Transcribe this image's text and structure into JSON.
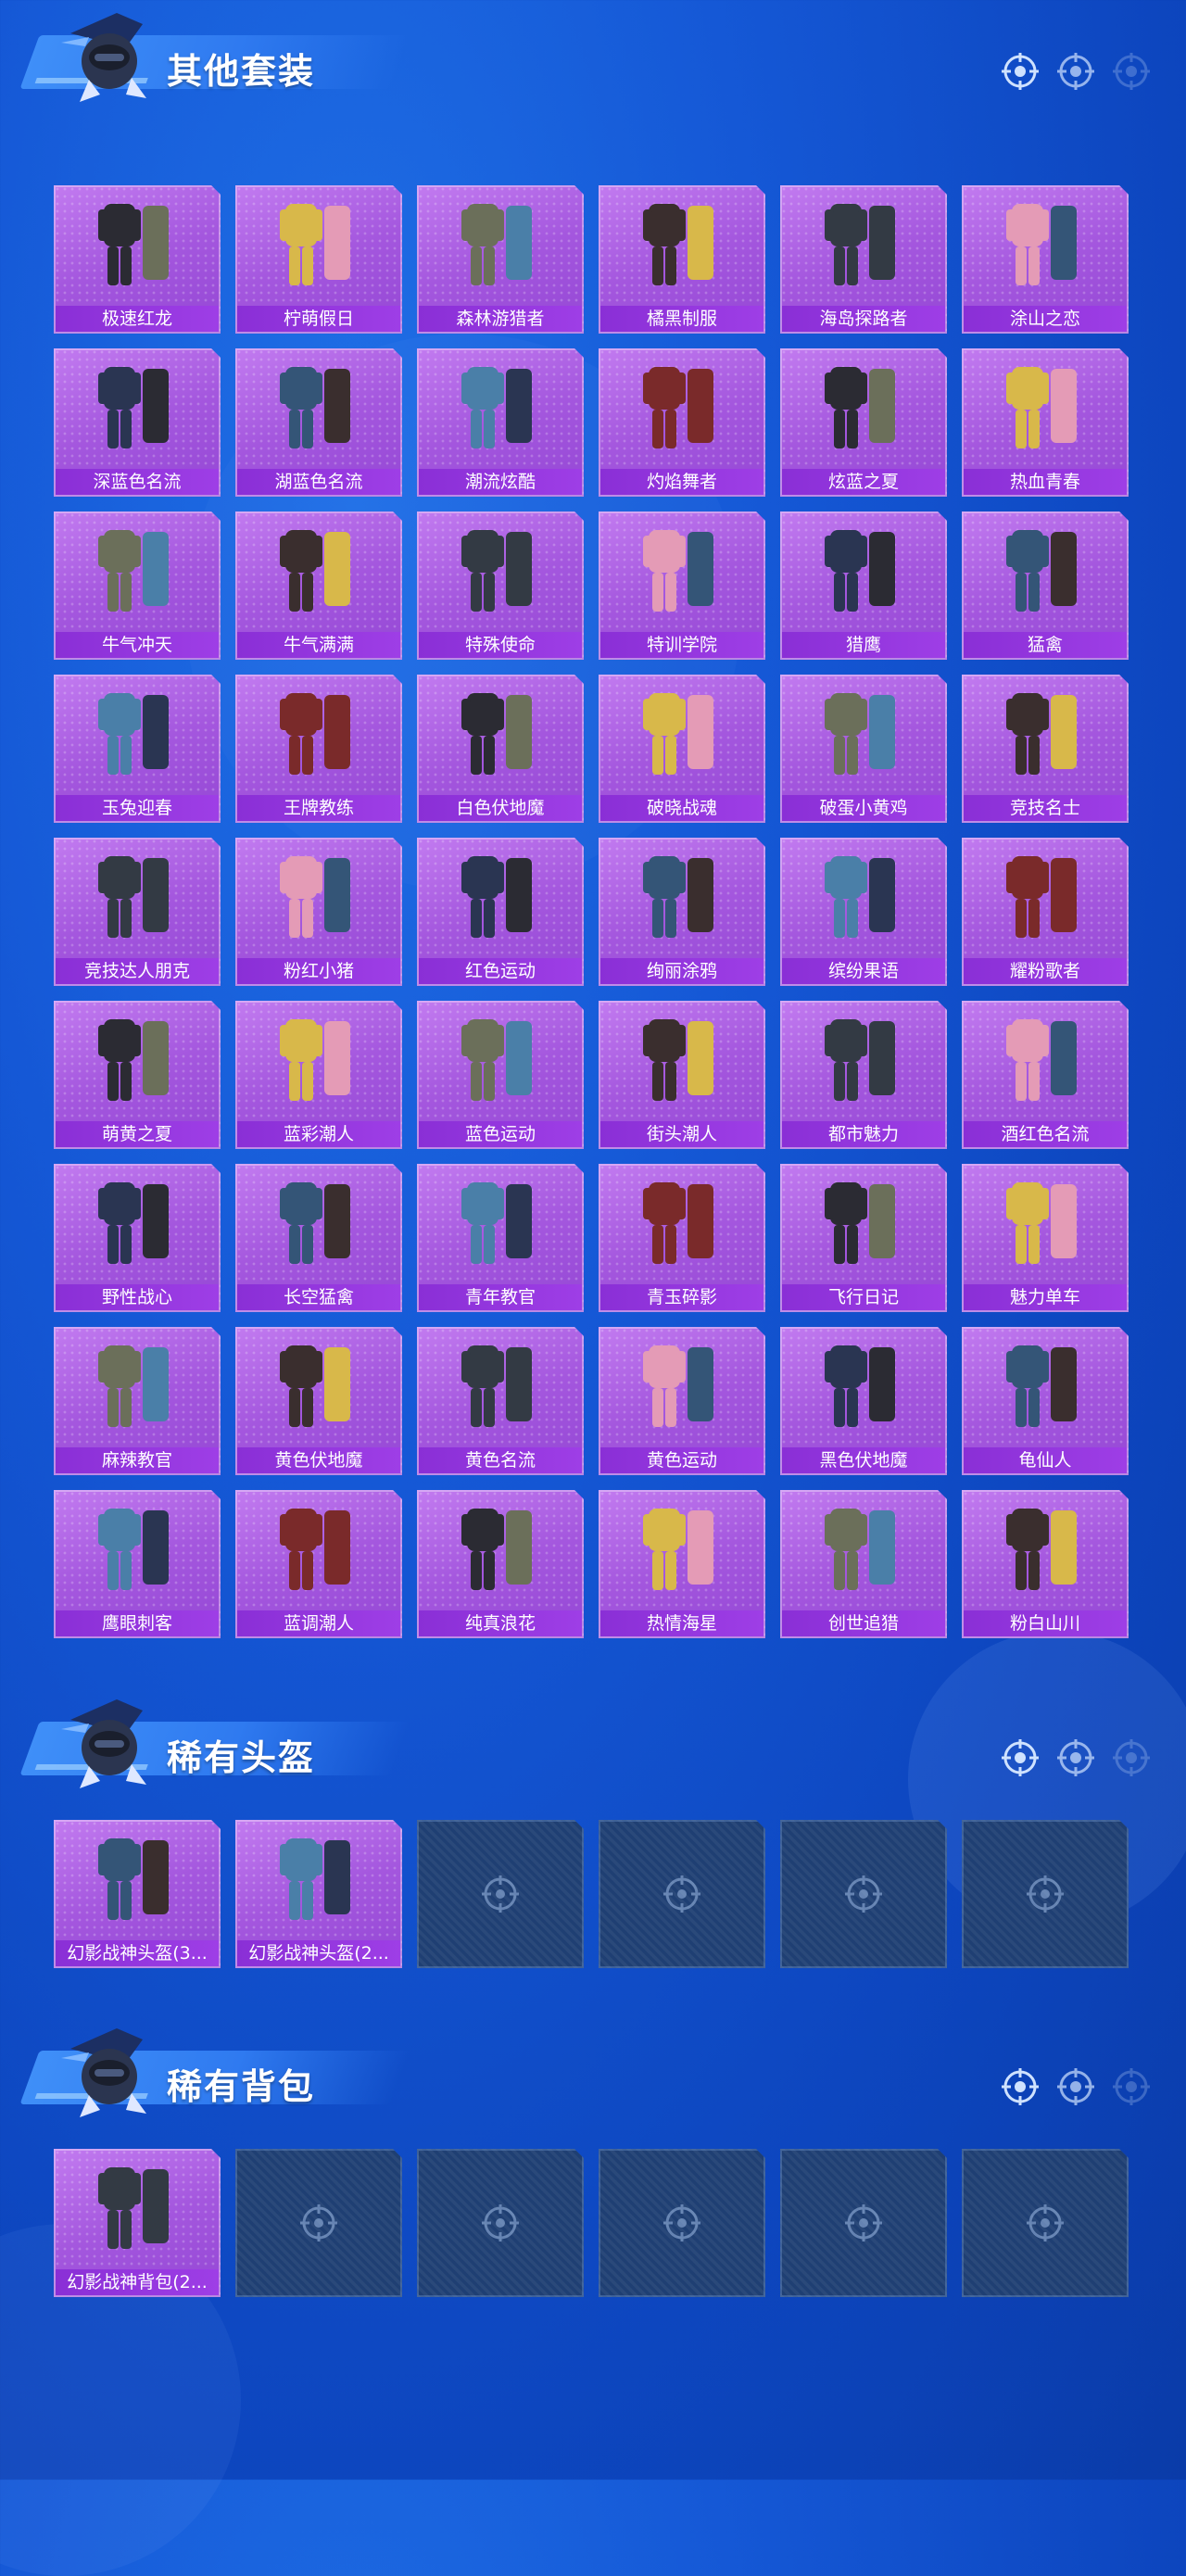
{
  "colors": {
    "background": "#1558d6",
    "card": "#a75be0",
    "label_bar": "#8a2fd6",
    "empty_card": "#1f3f73"
  },
  "sections": [
    {
      "title": "其他套装",
      "items": [
        "极速红龙",
        "柠萌假日",
        "森林游猎者",
        "橘黑制服",
        "海岛探路者",
        "涂山之恋",
        "深蓝色名流",
        "湖蓝色名流",
        "潮流炫酷",
        "灼焰舞者",
        "炫蓝之夏",
        "热血青春",
        "牛气冲天",
        "牛气满满",
        "特殊使命",
        "特训学院",
        "猎鹰",
        "猛禽",
        "玉兔迎春",
        "王牌教练",
        "白色伏地魔",
        "破晓战魂",
        "破蛋小黄鸡",
        "竞技名士",
        "竞技达人朋克",
        "粉红小猪",
        "红色运动",
        "绚丽涂鸦",
        "缤纷果语",
        "耀粉歌者",
        "萌黄之夏",
        "蓝彩潮人",
        "蓝色运动",
        "街头潮人",
        "都市魅力",
        "酒红色名流",
        "野性战心",
        "长空猛禽",
        "青年教官",
        "青玉碎影",
        "飞行日记",
        "魅力单车",
        "麻辣教官",
        "黄色伏地魔",
        "黄色名流",
        "黄色运动",
        "黑色伏地魔",
        "龟仙人",
        "鹰眼刺客",
        "蓝调潮人",
        "纯真浪花",
        "热情海星",
        "创世追猎",
        "粉白山川"
      ]
    },
    {
      "title": "稀有头盔",
      "items": [
        "幻影战神头盔(3...",
        "幻影战神头盔(2..."
      ],
      "empty_slots": 4
    },
    {
      "title": "稀有背包",
      "items": [
        "幻影战神背包(2..."
      ],
      "empty_slots": 5
    }
  ]
}
